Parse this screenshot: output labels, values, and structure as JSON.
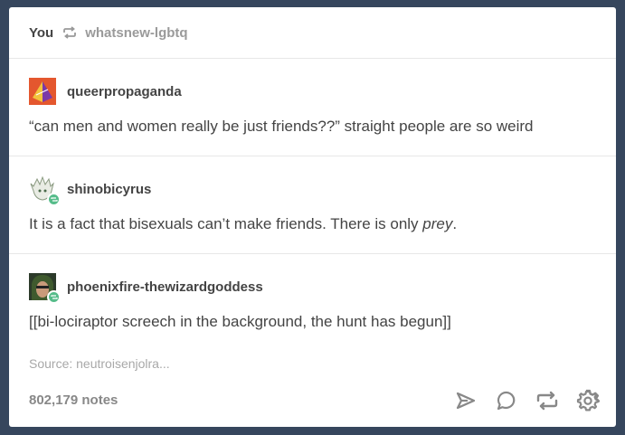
{
  "header": {
    "you_label": "You",
    "reblog_icon": "reblog-icon",
    "source_blog": "whatsnew-lgbtq"
  },
  "posts": [
    {
      "username": "queerpropaganda",
      "avatar": "pyramid-avatar",
      "text": "“can men and women really be just friends??” straight people are so weird"
    },
    {
      "username": "shinobicyrus",
      "avatar": "white-haired-character-avatar",
      "text_main": "It is a fact that bisexuals can’t make friends. There is only ",
      "text_em": "prey",
      "text_end": "."
    },
    {
      "username": "phoenixfire-thewizardgoddess",
      "avatar": "green-hooded-character-avatar",
      "text": "[[bi-lociraptor screech in the background, the hunt has begun]]"
    }
  ],
  "source": "Source: neutroisenjolra...",
  "footer": {
    "notes": "802,179 notes",
    "icons": [
      "send-icon",
      "reply-icon",
      "reblog-icon",
      "settings-icon"
    ]
  },
  "colors": {
    "background": "#36465d",
    "card": "#ffffff",
    "reblog_badge": "#56bc8a",
    "text": "#444444",
    "muted": "#9a9a9a"
  }
}
